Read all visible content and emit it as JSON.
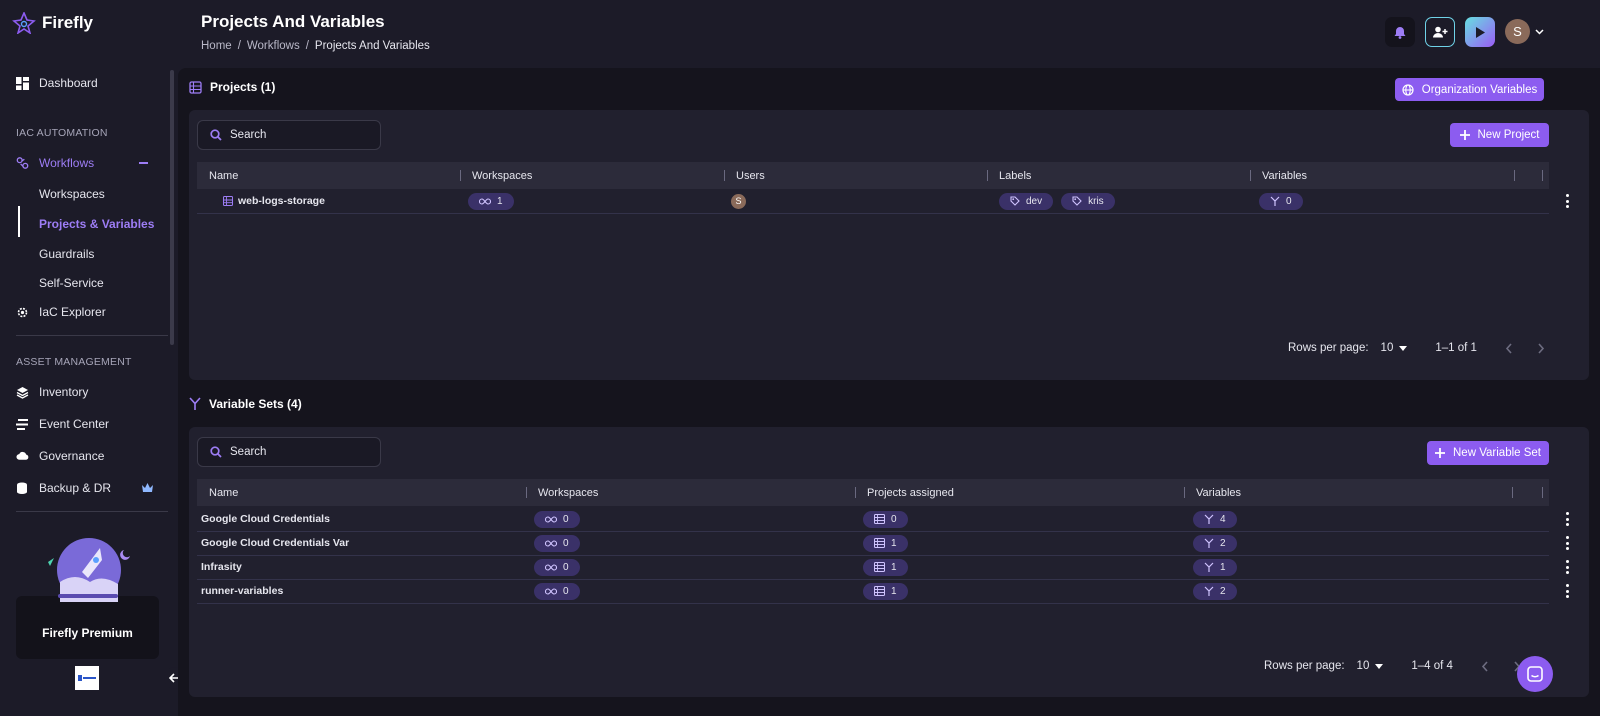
{
  "app": {
    "name": "Firefly"
  },
  "colors": {
    "accent": "#8c5cf0",
    "pill_bg": "#3a3168",
    "background": "#1c1b28"
  },
  "sidebar": {
    "dashboard": "Dashboard",
    "section_iac": "IAC AUTOMATION",
    "workflows": "Workflows",
    "workflows_sub": [
      "Workspaces",
      "Projects & Variables",
      "Guardrails",
      "Self-Service"
    ],
    "iac_explorer": "IaC Explorer",
    "section_asset": "ASSET MANAGEMENT",
    "inventory": "Inventory",
    "event_center": "Event Center",
    "governance": "Governance",
    "backup": "Backup & DR",
    "premium": "Firefly Premium"
  },
  "header": {
    "title": "Projects And Variables",
    "breadcrumb": [
      "Home",
      "/",
      "Workflows",
      "/",
      "Projects And Variables"
    ],
    "avatar_initial": "S"
  },
  "projects": {
    "title": "Projects (1)",
    "org_vars_button": "Organization Variables",
    "search_placeholder": "Search",
    "new_button": "New Project",
    "columns": [
      "Name",
      "Workspaces",
      "Users",
      "Labels",
      "Variables"
    ],
    "rows": [
      {
        "name": "web-logs-storage",
        "workspaces": "1",
        "user": "S",
        "labels": [
          "dev",
          "kris"
        ],
        "variables": "0"
      }
    ],
    "pager": {
      "rows_label": "Rows per page:",
      "rows_value": "10",
      "range": "1–1 of 1"
    }
  },
  "variable_sets": {
    "title": "Variable Sets (4)",
    "search_placeholder": "Search",
    "new_button": "New Variable Set",
    "columns": [
      "Name",
      "Workspaces",
      "Projects assigned",
      "Variables"
    ],
    "rows": [
      {
        "name": "Google Cloud Credentials",
        "workspaces": "0",
        "projects": "0",
        "variables": "4"
      },
      {
        "name": "Google Cloud Credentials Var",
        "workspaces": "0",
        "projects": "1",
        "variables": "2"
      },
      {
        "name": "Infrasity",
        "workspaces": "0",
        "projects": "1",
        "variables": "1"
      },
      {
        "name": "runner-variables",
        "workspaces": "0",
        "projects": "1",
        "variables": "2"
      }
    ],
    "pager": {
      "rows_label": "Rows per page:",
      "rows_value": "10",
      "range": "1–4 of 4"
    }
  }
}
